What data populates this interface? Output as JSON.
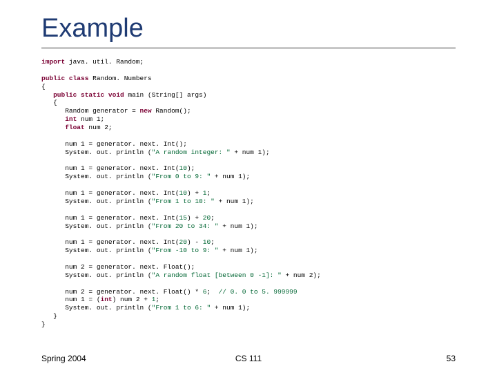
{
  "title": "Example",
  "code": {
    "l01a": "import",
    "l01b": " java. util. Random;",
    "l02a": "public class",
    "l02b": " Random. Numbers",
    "l03": "{",
    "l04a": "   public static void",
    "l04b": " main (String[] args)",
    "l05": "   {",
    "l06a": "      Random generator = ",
    "l06b": "new",
    "l06c": " Random();",
    "l07a": "      int",
    "l07b": " num 1;",
    "l08a": "      float",
    "l08b": " num 2;",
    "l09": "      num 1 = generator. next. Int();",
    "l10a": "      System. out. println (",
    "l10b": "\"A random integer: \"",
    "l10c": " + num 1);",
    "l11": "      num 1 = generator. next. Int(",
    "l11n": "10",
    "l11b": ");",
    "l12a": "      System. out. println (",
    "l12b": "\"From 0 to 9: \"",
    "l12c": " + num 1);",
    "l13a": "      num 1 = generator. next. Int(",
    "l13n": "10",
    "l13b": ") + ",
    "l13n2": "1",
    "l13c": ";",
    "l14a": "      System. out. println (",
    "l14b": "\"From 1 to 10: \"",
    "l14c": " + num 1);",
    "l15a": "      num 1 = generator. next. Int(",
    "l15n": "15",
    "l15b": ") + ",
    "l15n2": "20",
    "l15c": ";",
    "l16a": "      System. out. println (",
    "l16b": "\"From 20 to 34: \"",
    "l16c": " + num 1);",
    "l17a": "      num 1 = generator. next. Int(",
    "l17n": "20",
    "l17b": ") - ",
    "l17n2": "10",
    "l17c": ";",
    "l18a": "      System. out. println (",
    "l18b": "\"From -10 to 9: \"",
    "l18c": " + num 1);",
    "l19": "      num 2 = generator. next. Float();",
    "l20a": "      System. out. println (",
    "l20b": "\"A random float [between 0 -1]: \"",
    "l20c": " + num 2);",
    "l21a": "      num 2 = generator. next. Float() * ",
    "l21n": "6",
    "l21b": ";  ",
    "l21cmt": "// 0. 0 to 5. 999999",
    "l22a": "      num 1 = (",
    "l22b": "int",
    "l22c": ") num 2 + ",
    "l22n": "1",
    "l22d": ";",
    "l23a": "      System. out. println (",
    "l23b": "\"From 1 to 6: \"",
    "l23c": " + num 1);",
    "l24": "   }",
    "l25": "}"
  },
  "footer": {
    "left": "Spring 2004",
    "center": "CS 111",
    "right": "53"
  }
}
